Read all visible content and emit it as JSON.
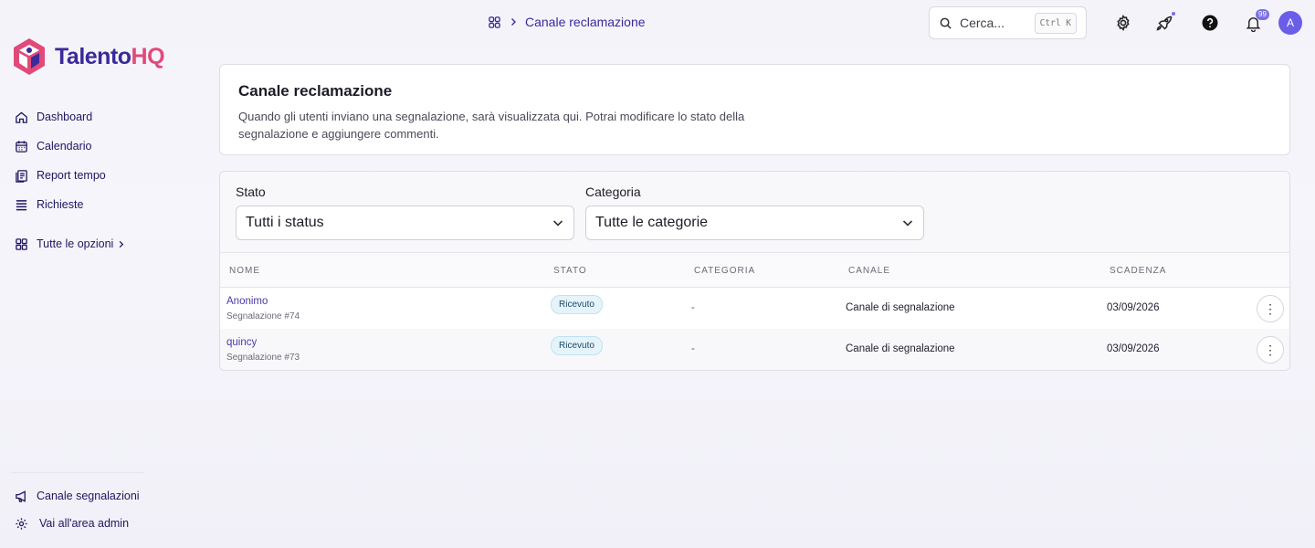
{
  "brand": {
    "name_part1": "Talento",
    "name_part2": "HQ",
    "primary": "#3a2a9a",
    "accent": "#e04a7a"
  },
  "sidebar": {
    "items": [
      {
        "label": "Dashboard",
        "icon": "home-icon"
      },
      {
        "label": "Calendario",
        "icon": "calendar-icon"
      },
      {
        "label": "Report tempo",
        "icon": "report-icon"
      },
      {
        "label": "Richieste",
        "icon": "list-icon"
      }
    ],
    "all_options": "Tutte le opzioni",
    "bottom": [
      {
        "label": "Canale segnalazioni",
        "icon": "megaphone-icon"
      },
      {
        "label": "Vai all'area admin",
        "icon": "gear-icon"
      }
    ]
  },
  "header": {
    "breadcrumb": "Canale reclamazione",
    "search_placeholder": "Cerca...",
    "search_shortcut": "Ctrl K",
    "notifications_count": "99",
    "avatar_initial": "A"
  },
  "intro": {
    "title": "Canale reclamazione",
    "description": "Quando gli utenti inviano una segnalazione, sarà visualizzata qui. Potrai modificare lo stato della segnalazione e aggiungere commenti."
  },
  "filters": {
    "status_label": "Stato",
    "status_value": "Tutti i status",
    "category_label": "Categoria",
    "category_value": "Tutte le categorie"
  },
  "table": {
    "columns": [
      "NOME",
      "STATO",
      "CATEGORIA",
      "CANALE",
      "SCADENZA"
    ],
    "rows": [
      {
        "name": "Anonimo",
        "sub": "Segnalazione #74",
        "status": "Ricevuto",
        "category": "-",
        "channel": "Canale di segnalazione",
        "due": "03/09/2026"
      },
      {
        "name": "quincy",
        "sub": "Segnalazione #73",
        "status": "Ricevuto",
        "category": "-",
        "channel": "Canale di segnalazione",
        "due": "03/09/2026"
      }
    ]
  }
}
